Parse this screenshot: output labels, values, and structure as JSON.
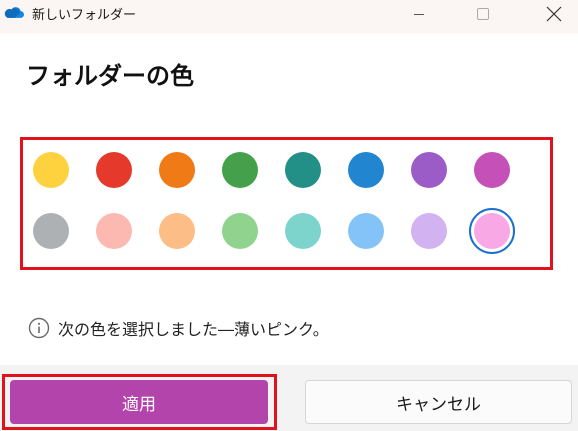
{
  "titlebar": {
    "app_icon": "onedrive-cloud-icon",
    "title": "新しいフォルダー",
    "controls": [
      "minimize-icon",
      "maximize-icon",
      "close-icon"
    ]
  },
  "heading": "フォルダーの色",
  "palette": {
    "rows": [
      [
        "#fdd23e",
        "#e53a2b",
        "#f07a16",
        "#44a04a",
        "#239088",
        "#2185d0",
        "#9b5cc7",
        "#c450b8"
      ],
      [
        "#adb1b4",
        "#fcb9b1",
        "#fdbd86",
        "#8fd38f",
        "#7dd4cc",
        "#83c3f7",
        "#d2b2f1",
        "#f7a8e5"
      ]
    ],
    "selected_row": 1,
    "selected_index": 7,
    "selection_ring_color": "#1a6fcf",
    "highlight_color": "#e0131d"
  },
  "info": {
    "icon": "info-circle-icon",
    "text": "次の色を選択しました―薄いピンク。"
  },
  "footer": {
    "apply_label": "適用",
    "cancel_label": "キャンセル",
    "accent_color": "#b344ac"
  }
}
